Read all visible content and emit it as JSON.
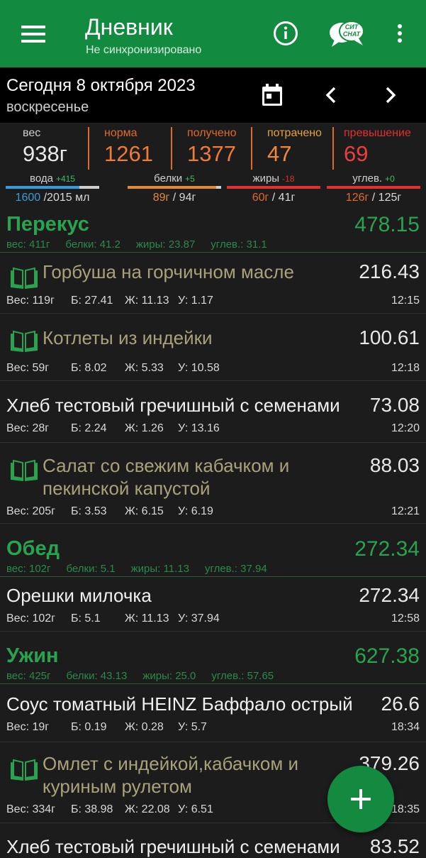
{
  "app": {
    "title": "Дневник",
    "sync_status": "Не синхронизировано",
    "chat_badge": [
      "СИТ",
      "CHAT"
    ]
  },
  "date": {
    "main": "Сегодня 8 октября 2023",
    "weekday": "воскресенье"
  },
  "stats": [
    {
      "label": "вес",
      "value": "938г",
      "color": "#cfcfcf",
      "value_color": "#e8e8e8"
    },
    {
      "label": "норма",
      "value": "1261",
      "color": "#e06a2c",
      "value_color": "#ef7a3a"
    },
    {
      "label": "получено",
      "value": "1377",
      "color": "#e06a2c",
      "value_color": "#ef7a3a"
    },
    {
      "label": "потрачено",
      "value": "47",
      "color": "#e8a040",
      "value_color": "#ef8a3a"
    },
    {
      "label": "превышение",
      "value": "69",
      "color": "#e03030",
      "value_color": "#e84040"
    }
  ],
  "macros": [
    {
      "label": "вода",
      "delta": "+415",
      "delta_color": "#3fbf5f",
      "value_main": "1600",
      "value_rest": " /2015 мл",
      "main_color": "#3a9ad8",
      "rest_color": "#d8d8d8",
      "bar_color": "#3a9ad8",
      "fill": 0.79
    },
    {
      "label": "белки",
      "delta": "+5",
      "delta_color": "#3fbf5f",
      "value_main": "89г",
      "value_rest": " / 94г",
      "main_color": "#e08a3a",
      "rest_color": "#d8d8d8",
      "bar_color": "#e08a3a",
      "fill": 0.95
    },
    {
      "label": "жиры",
      "delta": "-18",
      "delta_color": "#e03030",
      "value_main": "60г",
      "value_rest": " / 41г",
      "main_color": "#e06a2c",
      "rest_color": "#d8d8d8",
      "bar_color": "#e03030",
      "fill": 1.0
    },
    {
      "label": "углев.",
      "delta": "+0",
      "delta_color": "#3fbf5f",
      "value_main": "126г",
      "value_rest": " / 125г",
      "main_color": "#e06a2c",
      "rest_color": "#d8d8d8",
      "bar_color": "#e03030",
      "fill": 1.0
    }
  ],
  "meals": [
    {
      "name": "Перекус",
      "kcal": "478.15",
      "summary": [
        "вес: 411г",
        "белки: 41.2",
        "жиры: 23.87",
        "углев.: 31.1"
      ],
      "items": [
        {
          "name": [
            "Горбуша на горчичном масле"
          ],
          "recipe": true,
          "kcal": "216.43",
          "weight": "Вес: 119г",
          "protein": "Б: 27.41",
          "fat": "Ж: 11.13",
          "carbs": "У: 1.17",
          "time": "12:15"
        },
        {
          "name": [
            "Котлеты из индейки"
          ],
          "recipe": true,
          "kcal": "100.61",
          "weight": "Вес: 59г",
          "protein": "Б: 8.02",
          "fat": "Ж: 5.33",
          "carbs": "У: 10.58",
          "time": "12:18"
        },
        {
          "name": [
            "Хлеб тестовый гречишный с семенами"
          ],
          "recipe": false,
          "kcal": "73.08",
          "weight": "Вес: 28г",
          "protein": "Б: 2.24",
          "fat": "Ж: 1.26",
          "carbs": "У: 13.16",
          "time": "12:20"
        },
        {
          "name": [
            "Салат со свежим кабачком и",
            "пекинской капустой"
          ],
          "recipe": true,
          "kcal": "88.03",
          "weight": "Вес: 205г",
          "protein": "Б: 3.53",
          "fat": "Ж: 6.15",
          "carbs": "У: 6.19",
          "time": "12:21"
        }
      ]
    },
    {
      "name": "Обед",
      "kcal": "272.34",
      "summary": [
        "вес: 102г",
        "белки: 5.1",
        "жиры: 11.13",
        "углев.: 37.94"
      ],
      "items": [
        {
          "name": [
            "Орешки милочка"
          ],
          "recipe": false,
          "kcal": "272.34",
          "weight": "Вес: 102г",
          "protein": "Б: 5.1",
          "fat": "Ж: 11.13",
          "carbs": "У: 37.94",
          "time": "12:58"
        }
      ]
    },
    {
      "name": "Ужин",
      "kcal": "627.38",
      "summary": [
        "вес: 425г",
        "белки: 43.13",
        "жиры: 25.0",
        "углев.: 57.65"
      ],
      "items": [
        {
          "name": [
            "Соус томатный HEINZ Баффало острый"
          ],
          "recipe": false,
          "kcal": "26.6",
          "weight": "Вес: 19г",
          "protein": "Б: 0.19",
          "fat": "Ж: 0.28",
          "carbs": "У: 5.7",
          "time": "18:34"
        },
        {
          "name": [
            "Омлет с индейкой,кабачком и",
            "куриным рулетом"
          ],
          "recipe": true,
          "kcal": "379.26",
          "weight": "Вес: 334г",
          "protein": "Б: 38.98",
          "fat": "Ж: 22.08",
          "carbs": "У: 6.51",
          "time": "18:35"
        },
        {
          "name": [
            "Хлеб тестовый гречишный с семенами"
          ],
          "recipe": false,
          "kcal": "83.52",
          "weight": "",
          "protein": "",
          "fat": "",
          "carbs": "",
          "time": ""
        }
      ]
    }
  ],
  "icons": {
    "menu": "hamburger-menu-icon",
    "info": "info-circle-icon",
    "chat": "chat-bubble-icon",
    "more": "vertical-dots-icon",
    "calendar": "calendar-icon",
    "prev": "chevron-left-icon",
    "next": "chevron-right-icon",
    "recipe": "open-book-icon",
    "add": "plus-icon"
  },
  "colors": {
    "appbar": "#128a3f",
    "accent_green": "#2aa34f",
    "background": "#1c1c1c"
  }
}
